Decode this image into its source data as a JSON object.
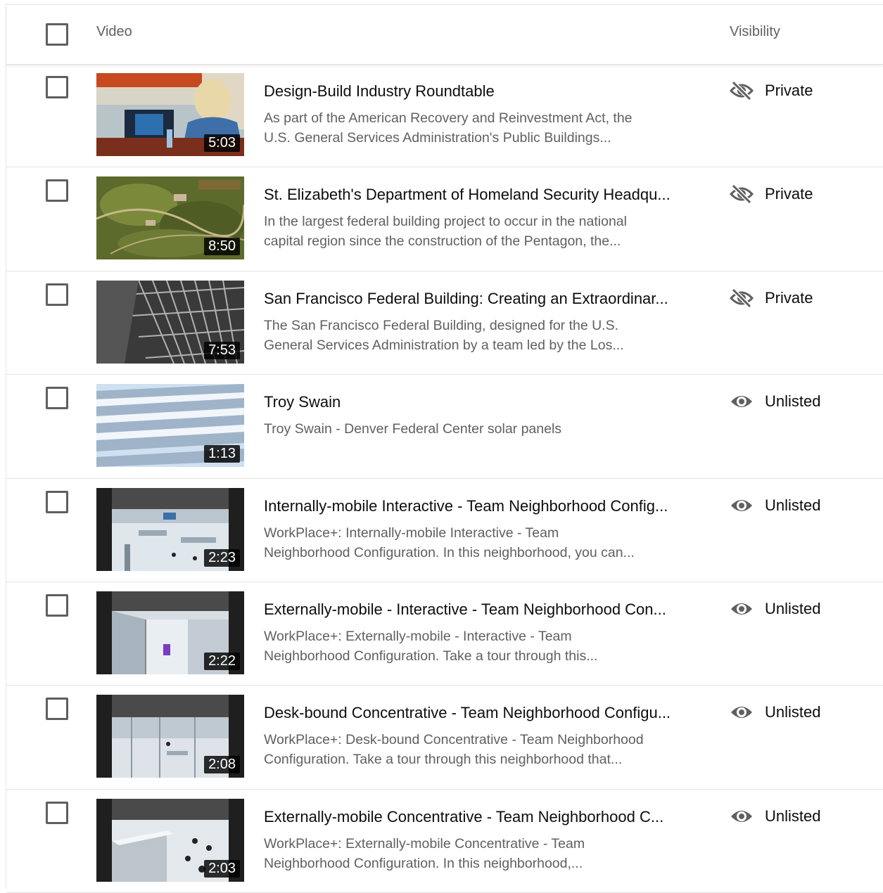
{
  "header": {
    "video_label": "Video",
    "visibility_label": "Visibility"
  },
  "videos": [
    {
      "title": "Design-Build Industry Roundtable",
      "desc1": "As part of the American Recovery and Reinvestment Act, the",
      "desc2": "U.S. General Services Administration's Public Buildings...",
      "duration": "5:03",
      "visibility": "Private",
      "visibility_icon": "eye-off-icon"
    },
    {
      "title": "St. Elizabeth's Department of Homeland Security Headqu...",
      "desc1": "In the largest federal building project to occur in the national",
      "desc2": "capital region since the construction of the Pentagon, the...",
      "duration": "8:50",
      "visibility": "Private",
      "visibility_icon": "eye-off-icon"
    },
    {
      "title": "San Francisco Federal Building: Creating an Extraordinar...",
      "desc1": "The San Francisco Federal Building, designed for the U.S.",
      "desc2": "General Services Administration by a team led by the Los...",
      "duration": "7:53",
      "visibility": "Private",
      "visibility_icon": "eye-off-icon"
    },
    {
      "title": "Troy Swain",
      "desc1": "Troy Swain - Denver Federal Center solar panels",
      "desc2": "",
      "duration": "1:13",
      "visibility": "Unlisted",
      "visibility_icon": "eye-icon"
    },
    {
      "title": "Internally-mobile Interactive - Team Neighborhood Config...",
      "desc1": "WorkPlace+: Internally-mobile Interactive - Team",
      "desc2": "Neighborhood Configuration. In this neighborhood, you can...",
      "duration": "2:23",
      "visibility": "Unlisted",
      "visibility_icon": "eye-icon"
    },
    {
      "title": "Externally-mobile - Interactive - Team Neighborhood Con...",
      "desc1": "WorkPlace+: Externally-mobile - Interactive - Team",
      "desc2": "Neighborhood Configuration. Take a tour through this...",
      "duration": "2:22",
      "visibility": "Unlisted",
      "visibility_icon": "eye-icon"
    },
    {
      "title": "Desk-bound Concentrative - Team Neighborhood Configu...",
      "desc1": "WorkPlace+: Desk-bound Concentrative - Team Neighborhood",
      "desc2": "Configuration. Take a tour through this neighborhood that...",
      "duration": "2:08",
      "visibility": "Unlisted",
      "visibility_icon": "eye-icon"
    },
    {
      "title": "Externally-mobile Concentrative - Team Neighborhood C...",
      "desc1": "WorkPlace+: Externally-mobile Concentrative - Team",
      "desc2": "Neighborhood Configuration. In this neighborhood,...",
      "duration": "2:03",
      "visibility": "Unlisted",
      "visibility_icon": "eye-icon"
    }
  ]
}
